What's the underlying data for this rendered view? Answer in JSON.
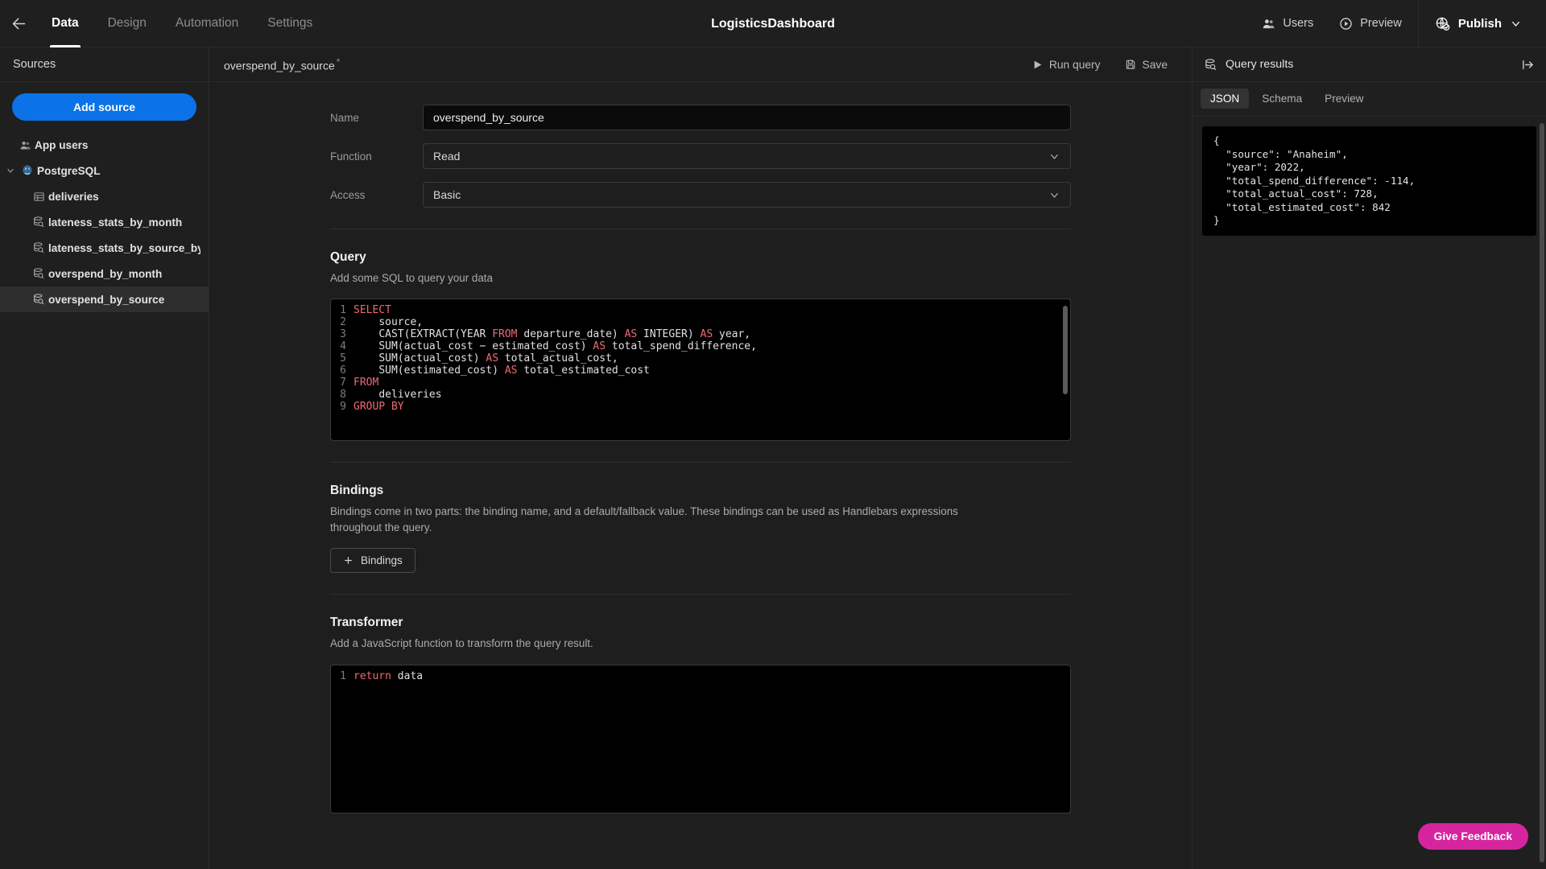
{
  "topbar": {
    "back_icon": "arrow-left-icon",
    "app_title": "LogisticsDashboard",
    "tabs": [
      {
        "label": "Data",
        "active": true
      },
      {
        "label": "Design",
        "active": false
      },
      {
        "label": "Automation",
        "active": false
      },
      {
        "label": "Settings",
        "active": false
      }
    ],
    "users_label": "Users",
    "users_icon": "users-icon",
    "preview_label": "Preview",
    "preview_icon": "play-circle-icon",
    "publish_label": "Publish",
    "publish_icon": "globe-check-icon",
    "publish_chevron_icon": "chevron-down-icon"
  },
  "sidebar": {
    "heading": "Sources",
    "add_source_label": "Add source",
    "tree": [
      {
        "label": "App users",
        "icon": "users-icon",
        "level": 0,
        "selected": false,
        "expandable": false
      },
      {
        "label": "PostgreSQL",
        "icon": "postgresql-icon",
        "level": 0,
        "selected": false,
        "expandable": true,
        "expanded": true
      },
      {
        "label": "deliveries",
        "icon": "table-icon",
        "level": 1,
        "selected": false,
        "expandable": false
      },
      {
        "label": "lateness_stats_by_month",
        "icon": "query-icon",
        "level": 1,
        "selected": false,
        "expandable": false
      },
      {
        "label": "lateness_stats_by_source_by_year",
        "icon": "query-icon",
        "level": 1,
        "selected": false,
        "expandable": false
      },
      {
        "label": "overspend_by_month",
        "icon": "query-icon",
        "level": 1,
        "selected": false,
        "expandable": false
      },
      {
        "label": "overspend_by_source",
        "icon": "query-icon",
        "level": 1,
        "selected": true,
        "expandable": false
      }
    ]
  },
  "main": {
    "tab_title": "overspend_by_source",
    "unsaved_marker": "*",
    "run_query_label": "Run query",
    "run_query_icon": "play-icon",
    "save_label": "Save",
    "save_icon": "floppy-disk-icon",
    "fields": {
      "name_label": "Name",
      "name_value": "overspend_by_source",
      "function_label": "Function",
      "function_value": "Read",
      "access_label": "Access",
      "access_value": "Basic"
    },
    "query_section": {
      "title": "Query",
      "subtitle": "Add some SQL to query your data",
      "lines": [
        {
          "n": "1",
          "segs": [
            {
              "t": "SELECT",
              "k": true
            }
          ]
        },
        {
          "n": "2",
          "segs": [
            {
              "t": "    source,",
              "k": false
            }
          ]
        },
        {
          "n": "3",
          "segs": [
            {
              "t": "    CAST(EXTRACT(YEAR ",
              "k": false
            },
            {
              "t": "FROM",
              "k": true
            },
            {
              "t": " departure_date) ",
              "k": false
            },
            {
              "t": "AS",
              "k": true
            },
            {
              "t": " INTEGER) ",
              "k": false
            },
            {
              "t": "AS",
              "k": true
            },
            {
              "t": " year,",
              "k": false
            }
          ]
        },
        {
          "n": "4",
          "segs": [
            {
              "t": "    SUM(actual_cost − estimated_cost) ",
              "k": false
            },
            {
              "t": "AS",
              "k": true
            },
            {
              "t": " total_spend_difference,",
              "k": false
            }
          ]
        },
        {
          "n": "5",
          "segs": [
            {
              "t": "    SUM(actual_cost) ",
              "k": false
            },
            {
              "t": "AS",
              "k": true
            },
            {
              "t": " total_actual_cost,",
              "k": false
            }
          ]
        },
        {
          "n": "6",
          "segs": [
            {
              "t": "    SUM(estimated_cost) ",
              "k": false
            },
            {
              "t": "AS",
              "k": true
            },
            {
              "t": " total_estimated_cost",
              "k": false
            }
          ]
        },
        {
          "n": "7",
          "segs": [
            {
              "t": "FROM",
              "k": true
            }
          ]
        },
        {
          "n": "8",
          "segs": [
            {
              "t": "    deliveries",
              "k": false
            }
          ]
        },
        {
          "n": "9",
          "segs": [
            {
              "t": "GROUP BY",
              "k": true
            }
          ]
        }
      ]
    },
    "bindings_section": {
      "title": "Bindings",
      "subtitle": "Bindings come in two parts: the binding name, and a default/fallback value. These bindings can be used as Handlebars expressions throughout the query.",
      "button_label": "Bindings",
      "button_icon": "plus-icon"
    },
    "transformer_section": {
      "title": "Transformer",
      "subtitle": "Add a JavaScript function to transform the query result.",
      "lines": [
        {
          "n": "1",
          "segs": [
            {
              "t": "return",
              "k": true
            },
            {
              "t": " data",
              "k": false
            }
          ]
        }
      ]
    }
  },
  "results": {
    "title": "Query results",
    "title_icon": "query-icon",
    "collapse_icon": "collapse-panel-right-icon",
    "tabs": [
      {
        "label": "JSON",
        "active": true
      },
      {
        "label": "Schema",
        "active": false
      },
      {
        "label": "Preview",
        "active": false
      }
    ],
    "json_text": "{\n  \"source\": \"Anaheim\",\n  \"year\": 2022,\n  \"total_spend_difference\": -114,\n  \"total_actual_cost\": 728,\n  \"total_estimated_cost\": 842\n}",
    "feedback_label": "Give Feedback"
  },
  "colors": {
    "accent_blue": "#0b72e7",
    "feedback_pink": "#d6249f",
    "sql_keyword": "#ef6a73",
    "panel_bg": "#1f1f1f",
    "main_bg": "#1e1e1e"
  }
}
